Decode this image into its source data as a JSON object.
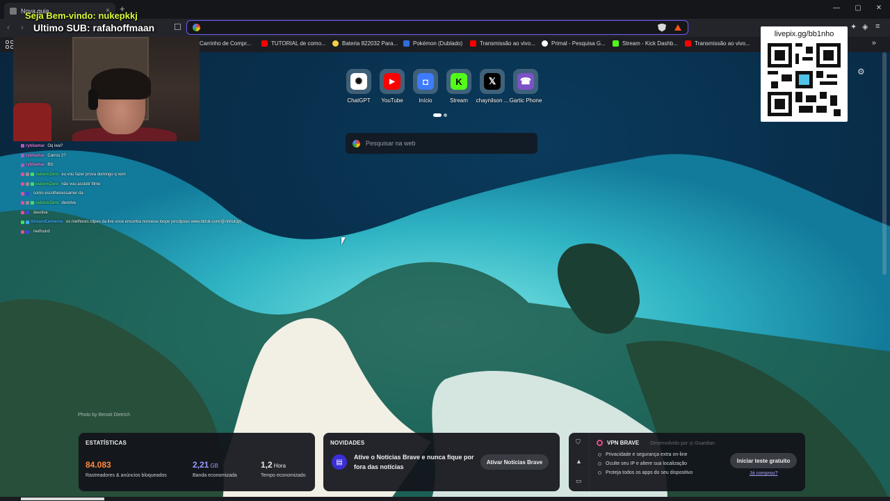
{
  "tab": {
    "title": "Nova guia",
    "close": "×"
  },
  "new_tab": "+",
  "window_controls": {
    "minimize": "—",
    "maximize": "▢",
    "close": "✕"
  },
  "nav": {
    "back": "‹",
    "forward": "›",
    "bookmark": "🔖"
  },
  "url": {
    "value": ""
  },
  "bookmarks": [
    {
      "label": "Carrinho de Compr...",
      "color": "#f2f2f2"
    },
    {
      "label": "TUTORIAL de como...",
      "color": "#ff0000"
    },
    {
      "label": "Bateria 822032 Para...",
      "color": "#f5d142"
    },
    {
      "label": "Pokémon (Dublado)",
      "color": "#2f6fdd"
    },
    {
      "label": "Transmissão ao vivo...",
      "color": "#ff0000"
    },
    {
      "label": "Primal - Pesquisa G...",
      "color": "#ffffff"
    },
    {
      "label": "Stream - Kick Dashb...",
      "color": "#53fc18"
    },
    {
      "label": "Transmissão ao vivo...",
      "color": "#ff0000"
    }
  ],
  "bookmarks_more": "»",
  "overlay": {
    "welcome": "Seja Bem-vindo: nukepkkj",
    "last_sub": "Ultimo SUB: rafahoffmaan",
    "qr_title": "livepix.gg/bb1nho"
  },
  "chat": [
    {
      "user": "rybbamar",
      "msg": "Oq iwa?",
      "color": "#e07ad0"
    },
    {
      "user": "rybbamar",
      "msg": "Carros 2?",
      "color": "#e07ad0"
    },
    {
      "user": "rybbamar",
      "msg": "Blz",
      "color": "#e07ad0"
    },
    {
      "user": "osbornZero",
      "msg": "eu vou fazer prova domingo q vem",
      "color": "#4cd964"
    },
    {
      "user": "osbornZero",
      "msg": "não vou assistir filme",
      "color": "#4cd964"
    },
    {
      "user": "",
      "msg": "como escolhenessamer da",
      "color": "#5b6cf0"
    },
    {
      "user": "osbornZero",
      "msg": "devolve",
      "color": "#4cd964"
    },
    {
      "user": "",
      "msg": "devolve",
      "color": "#5b6cf0"
    },
    {
      "user": "StreamElements",
      "msg": "os melhores clipes da live voce encontra nonoese loope (enclipses www.tiktok.com/@rinhotop)",
      "color": "#3aa8ff"
    },
    {
      "user": "",
      "msg": "reefound",
      "color": "#5b6cf0"
    }
  ],
  "top_sites": [
    {
      "label": "ChatGPT",
      "icon": "chatgpt-icon",
      "glyph": "✺",
      "bg": "#ffffff",
      "fg": "#111111"
    },
    {
      "label": "YouTube",
      "icon": "youtube-icon",
      "glyph": "▶",
      "bg": "#ff0000",
      "fg": "#ffffff"
    },
    {
      "label": "Início",
      "icon": "roblox-icon",
      "glyph": "◘",
      "bg": "#3d7bff",
      "fg": "#ffffff"
    },
    {
      "label": "Stream",
      "icon": "kick-icon",
      "glyph": "K",
      "bg": "#53fc18",
      "fg": "#000000"
    },
    {
      "label": "chaynilson ...",
      "icon": "x-icon",
      "glyph": "𝕏",
      "bg": "#000000",
      "fg": "#ffffff"
    },
    {
      "label": "Gartic Phone",
      "icon": "gartic-phone-icon",
      "glyph": "☎",
      "bg": "#7b52c7",
      "fg": "#ffffff"
    }
  ],
  "search": {
    "placeholder": "Pesquisar na web"
  },
  "photo_credit": "Photo by Benoit Dietrich",
  "stats": {
    "title": "ESTATÍSTICAS",
    "trackers": {
      "value": "84.083",
      "desc": "Rastreadores & anúncios bloqueados",
      "color": "#ff8a3d"
    },
    "bandwidth": {
      "value": "2,21",
      "unit": "GB",
      "desc": "Banda economizada",
      "color": "#9d9bff"
    },
    "time": {
      "value": "1,2",
      "unit": "Hora",
      "desc": "Tempo economizado",
      "color": "#f0f0f2"
    }
  },
  "news": {
    "title": "NOVIDADES",
    "text": "Ative o Notícias Brave e nunca fique por fora das notícias",
    "button": "Ativar Notícias Brave"
  },
  "vpn": {
    "title": "VPN BRAVE",
    "by": "Desenvolvido por ◎ Guardian",
    "features": [
      "Privacidade e segurança extra on-line",
      "Oculte seu IP e altere sua localização",
      "Proteja todos os apps do seu dispositivo"
    ],
    "button": "Iniciar teste gratuito",
    "link": "Já comprou?"
  }
}
